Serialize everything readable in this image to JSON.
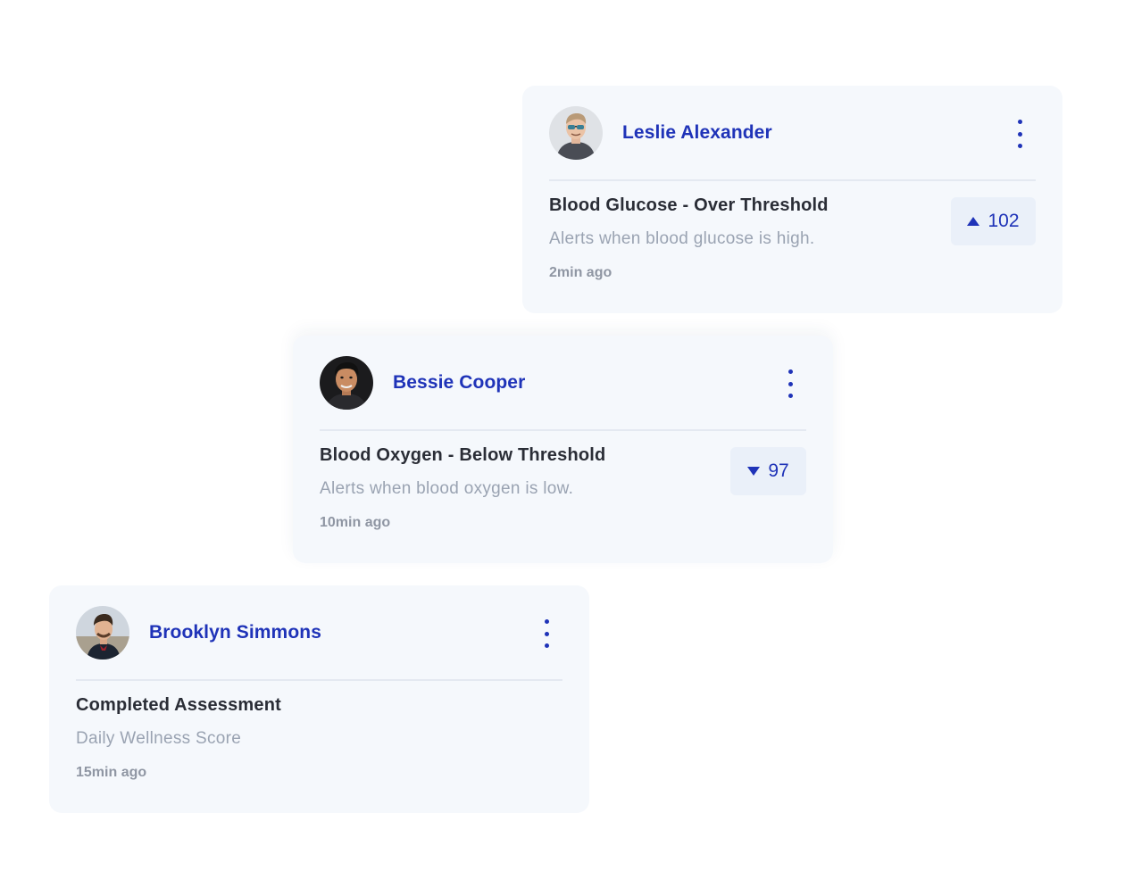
{
  "colors": {
    "accent": "#1f33b8",
    "card_bg": "#f5f8fc",
    "badge_bg": "#eaf0f9",
    "title_text": "#2a2d36",
    "muted_text": "#9aa3b2"
  },
  "cards": [
    {
      "user_name": "Leslie Alexander",
      "avatar_icon": "user-avatar-icon",
      "menu_icon": "more-vertical-icon",
      "alert_title": "Blood Glucose - Over Threshold",
      "alert_description": "Alerts when blood glucose is high.",
      "time_ago": "2min ago",
      "value": "102",
      "trend_icon": "triangle-up-icon"
    },
    {
      "user_name": "Bessie Cooper",
      "avatar_icon": "user-avatar-icon",
      "menu_icon": "more-vertical-icon",
      "alert_title": "Blood Oxygen - Below Threshold",
      "alert_description": "Alerts when blood oxygen is low.",
      "time_ago": "10min ago",
      "value": "97",
      "trend_icon": "triangle-down-icon"
    },
    {
      "user_name": "Brooklyn Simmons",
      "avatar_icon": "user-avatar-icon",
      "menu_icon": "more-vertical-icon",
      "alert_title": "Completed Assessment",
      "alert_description": "Daily Wellness Score",
      "time_ago": "15min ago"
    }
  ]
}
